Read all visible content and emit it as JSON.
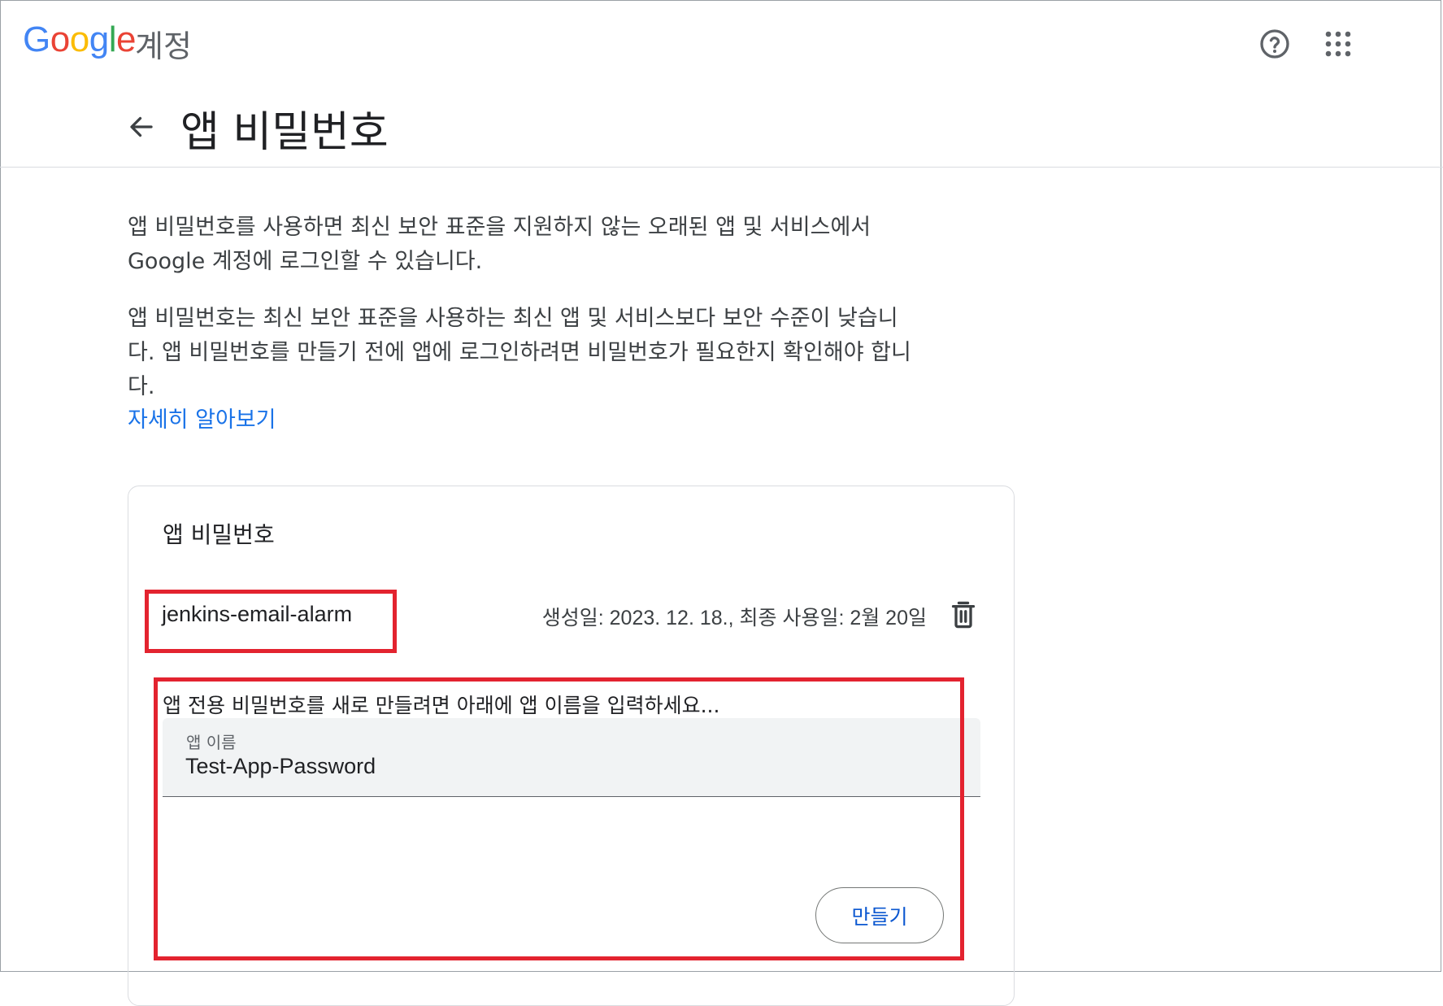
{
  "header": {
    "logo_letters": [
      {
        "ch": "G",
        "color": "#4285F4"
      },
      {
        "ch": "o",
        "color": "#EA4335"
      },
      {
        "ch": "o",
        "color": "#FBBC05"
      },
      {
        "ch": "g",
        "color": "#4285F4"
      },
      {
        "ch": "l",
        "color": "#34A853"
      },
      {
        "ch": "e",
        "color": "#EA4335"
      }
    ],
    "product": "계정",
    "help_icon": "help-circle-icon",
    "apps_icon": "apps-grid-icon"
  },
  "page": {
    "title": "앱 비밀번호",
    "back_icon": "arrow-back-icon"
  },
  "intro": {
    "paragraph1": "앱 비밀번호를 사용하면 최신 보안 표준을 지원하지 않는 오래된 앱 및 서비스에서 Google 계정에 로그인할 수 있습니다.",
    "paragraph2": "앱 비밀번호는 최신 보안 표준을 사용하는 최신 앱 및 서비스보다 보안 수준이 낮습니다. 앱 비밀번호를 만들기 전에 앱에 로그인하려면 비밀번호가 필요한지 확인해야 합니다.",
    "learn_more": "자세히 알아보기"
  },
  "card": {
    "title": "앱 비밀번호",
    "passwords": [
      {
        "name": "jenkins-email-alarm",
        "meta": "생성일: 2023. 12. 18., 최종 사용일: 2월 20일",
        "delete_icon": "trash-icon"
      }
    ],
    "create": {
      "prompt": "앱 전용 비밀번호를 새로 만들려면 아래에 앱 이름을 입력하세요...",
      "field_label": "앱 이름",
      "field_value": "Test-App-Password",
      "button": "만들기"
    }
  },
  "colors": {
    "accent": "#1a73e8",
    "button_text": "#0b57d0",
    "highlight_box": "#e3232f"
  }
}
